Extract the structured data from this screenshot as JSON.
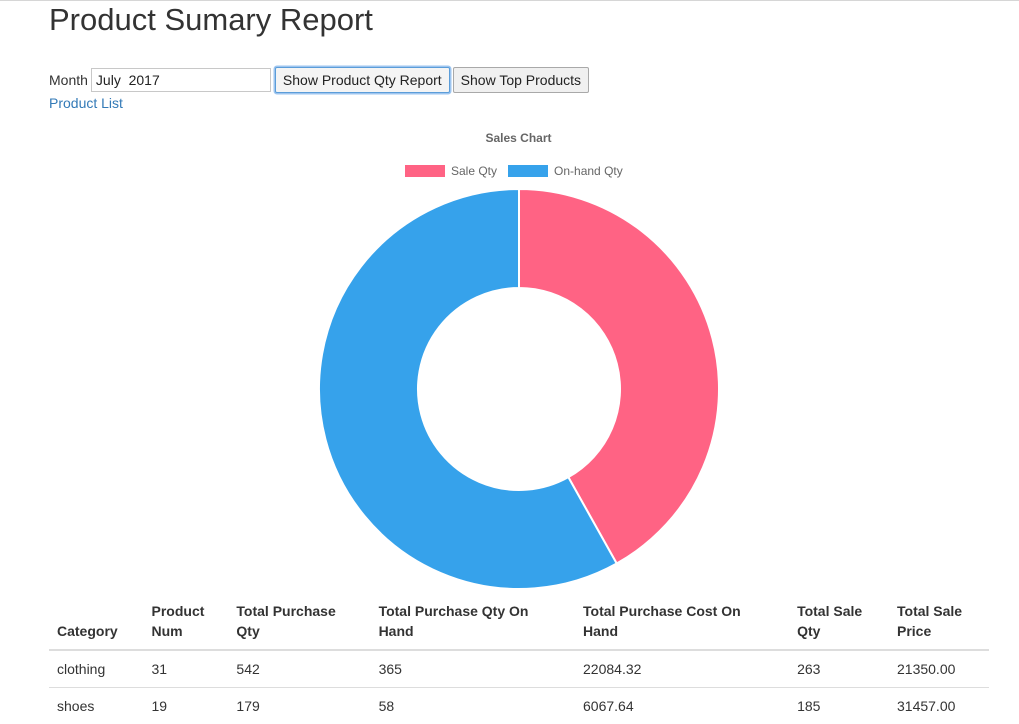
{
  "page": {
    "title": "Product Sumary Report"
  },
  "filter": {
    "month_label": "Month",
    "month_value": "July  2017",
    "show_qty_button": "Show Product Qty Report",
    "show_top_button": "Show Top Products",
    "product_list_link": "Product List"
  },
  "chart_data": {
    "type": "pie",
    "subtype": "doughnut",
    "title": "Sales Chart",
    "legend_position": "top",
    "series": [
      {
        "name": "Sale Qty",
        "value": 263,
        "color": "#ff6384"
      },
      {
        "name": "On-hand Qty",
        "value": 365,
        "color": "#36a2eb"
      }
    ]
  },
  "table": {
    "headers": [
      [
        "Category",
        ""
      ],
      [
        "Product",
        "Num"
      ],
      [
        "Total Purchase",
        "Qty"
      ],
      [
        "Total Purchase Qty On",
        "Hand"
      ],
      [
        "Total Purchase Cost On",
        "Hand"
      ],
      [
        "Total Sale",
        "Qty"
      ],
      [
        "Total Sale",
        "Price"
      ]
    ],
    "rows": [
      [
        "clothing",
        "31",
        "542",
        "365",
        "22084.32",
        "263",
        "21350.00"
      ],
      [
        "shoes",
        "19",
        "179",
        "58",
        "6067.64",
        "185",
        "31457.00"
      ]
    ]
  }
}
